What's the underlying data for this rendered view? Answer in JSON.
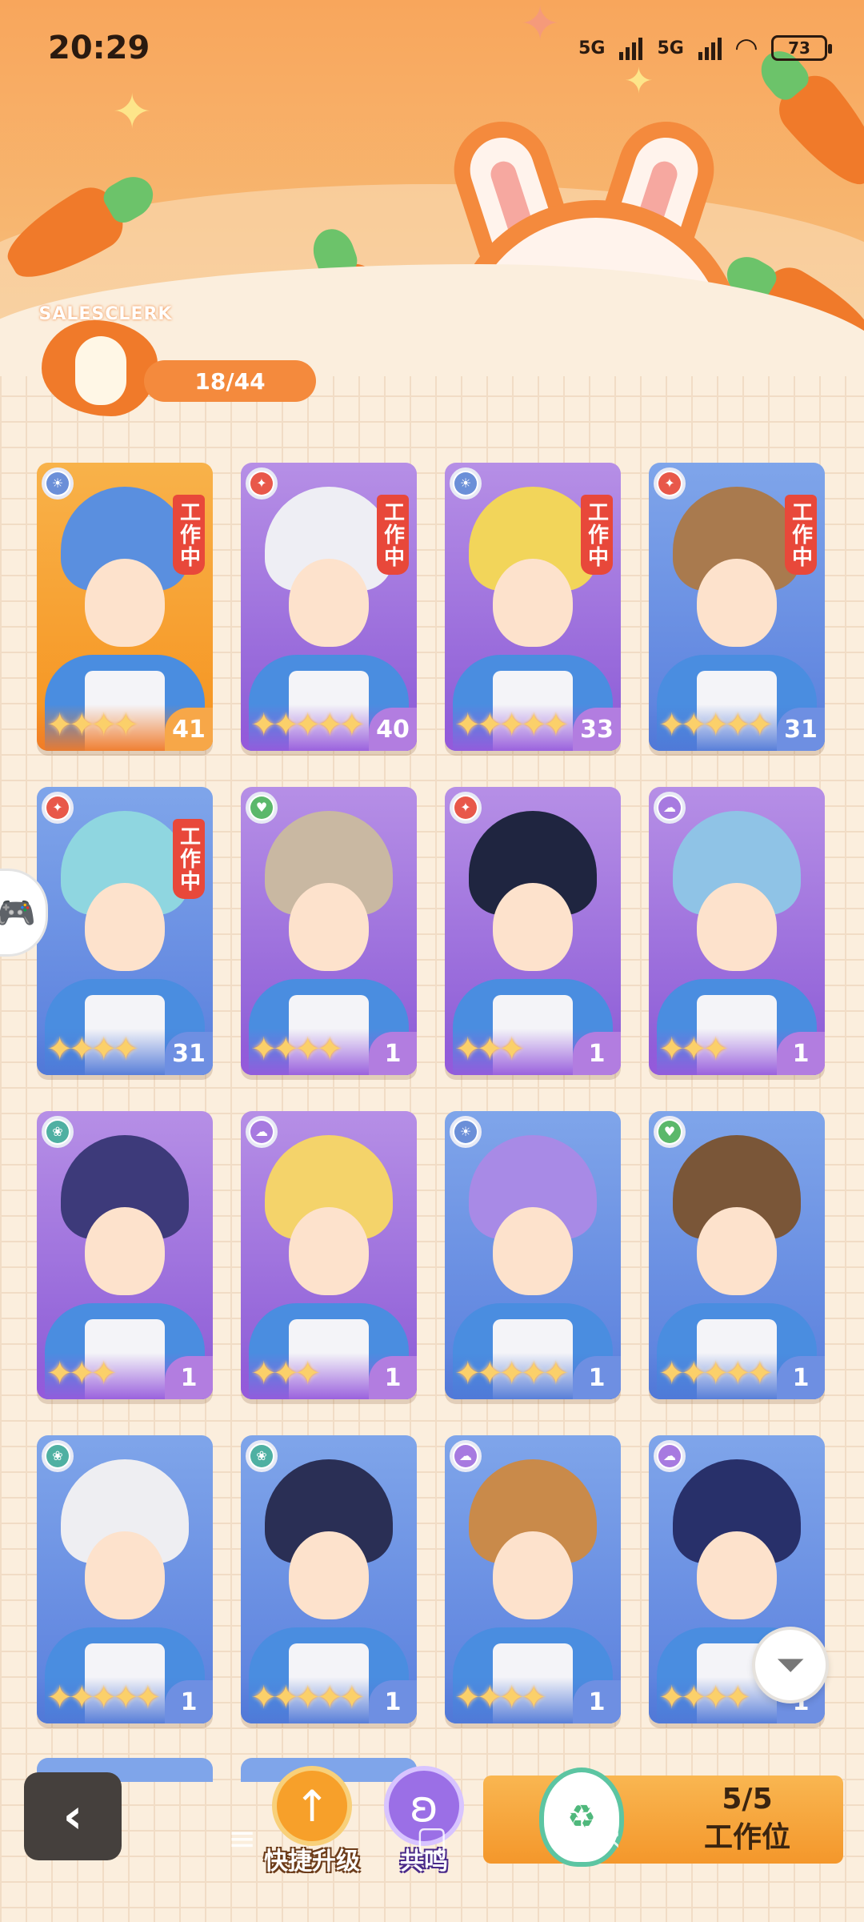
{
  "status_bar": {
    "time": "20:29",
    "network1": "5G",
    "network2": "5G",
    "battery": "73"
  },
  "header": {
    "badge_label": "SALESCLERK",
    "progress": "18/44"
  },
  "cards": [
    {
      "rarity": "orange",
      "element": "sun",
      "element_color": "#6b8fd8",
      "stars": 4,
      "level": "41",
      "working": true,
      "hair": "#5a8fdf",
      "working_label": "工作中"
    },
    {
      "rarity": "purple",
      "element": "star",
      "element_color": "#e8584a",
      "stars": 5,
      "level": "40",
      "working": true,
      "hair": "#eeeef4",
      "working_label": "工作中"
    },
    {
      "rarity": "purple",
      "element": "sun",
      "element_color": "#6b8fd8",
      "stars": 5,
      "level": "33",
      "working": true,
      "hair": "#f2d55a",
      "working_label": "工作中"
    },
    {
      "rarity": "blue",
      "element": "star",
      "element_color": "#e8584a",
      "stars": 5,
      "level": "31",
      "working": true,
      "hair": "#a97a4e",
      "working_label": "工作中"
    },
    {
      "rarity": "blue",
      "element": "star",
      "element_color": "#e8584a",
      "stars": 4,
      "level": "31",
      "working": true,
      "hair": "#8fd6e0",
      "working_label": "工作中"
    },
    {
      "rarity": "purple",
      "element": "strawberry",
      "element_color": "#5bb86b",
      "stars": 4,
      "level": "1",
      "working": false,
      "hair": "#c9b8a2",
      "working_label": ""
    },
    {
      "rarity": "purple",
      "element": "star",
      "element_color": "#e8584a",
      "stars": 3,
      "level": "1",
      "working": false,
      "hair": "#1f2540",
      "working_label": ""
    },
    {
      "rarity": "purple",
      "element": "cloud",
      "element_color": "#a77ae0",
      "stars": 3,
      "level": "1",
      "working": false,
      "hair": "#8fc3e6",
      "working_label": ""
    },
    {
      "rarity": "purple",
      "element": "leaf",
      "element_color": "#4fb0a2",
      "stars": 3,
      "level": "1",
      "working": false,
      "hair": "#3d3a7a",
      "working_label": ""
    },
    {
      "rarity": "purple",
      "element": "cloud",
      "element_color": "#a77ae0",
      "stars": 3,
      "level": "1",
      "working": false,
      "hair": "#f4d36a",
      "working_label": ""
    },
    {
      "rarity": "blue",
      "element": "sun",
      "element_color": "#6b8fd8",
      "stars": 5,
      "level": "1",
      "working": false,
      "hair": "#a88ae6",
      "working_label": ""
    },
    {
      "rarity": "blue",
      "element": "strawberry",
      "element_color": "#5bb86b",
      "stars": 5,
      "level": "1",
      "working": false,
      "hair": "#7a5638",
      "working_label": ""
    },
    {
      "rarity": "blue",
      "element": "leaf",
      "element_color": "#4fb0a2",
      "stars": 5,
      "level": "1",
      "working": false,
      "hair": "#eeeef2",
      "working_label": ""
    },
    {
      "rarity": "blue",
      "element": "leaf",
      "element_color": "#4fb0a2",
      "stars": 5,
      "level": "1",
      "working": false,
      "hair": "#2a2f55",
      "working_label": ""
    },
    {
      "rarity": "blue",
      "element": "cloud",
      "element_color": "#a77ae0",
      "stars": 4,
      "level": "1",
      "working": false,
      "hair": "#c98a4a",
      "working_label": ""
    },
    {
      "rarity": "blue",
      "element": "cloud",
      "element_color": "#a77ae0",
      "stars": 4,
      "level": "1",
      "working": false,
      "hair": "#28306a",
      "working_label": ""
    }
  ],
  "toolbar": {
    "upgrade_label": "快捷升级",
    "resonate_label": "共鸣",
    "workslot_count": "5/5",
    "workslot_label": "工作位"
  },
  "icons": {
    "back": "chevron-left-icon",
    "filter": "filter-icon",
    "upgrade": "arrow-up-icon",
    "resonate": "bunny-icon",
    "side": "gamepad-icon"
  }
}
